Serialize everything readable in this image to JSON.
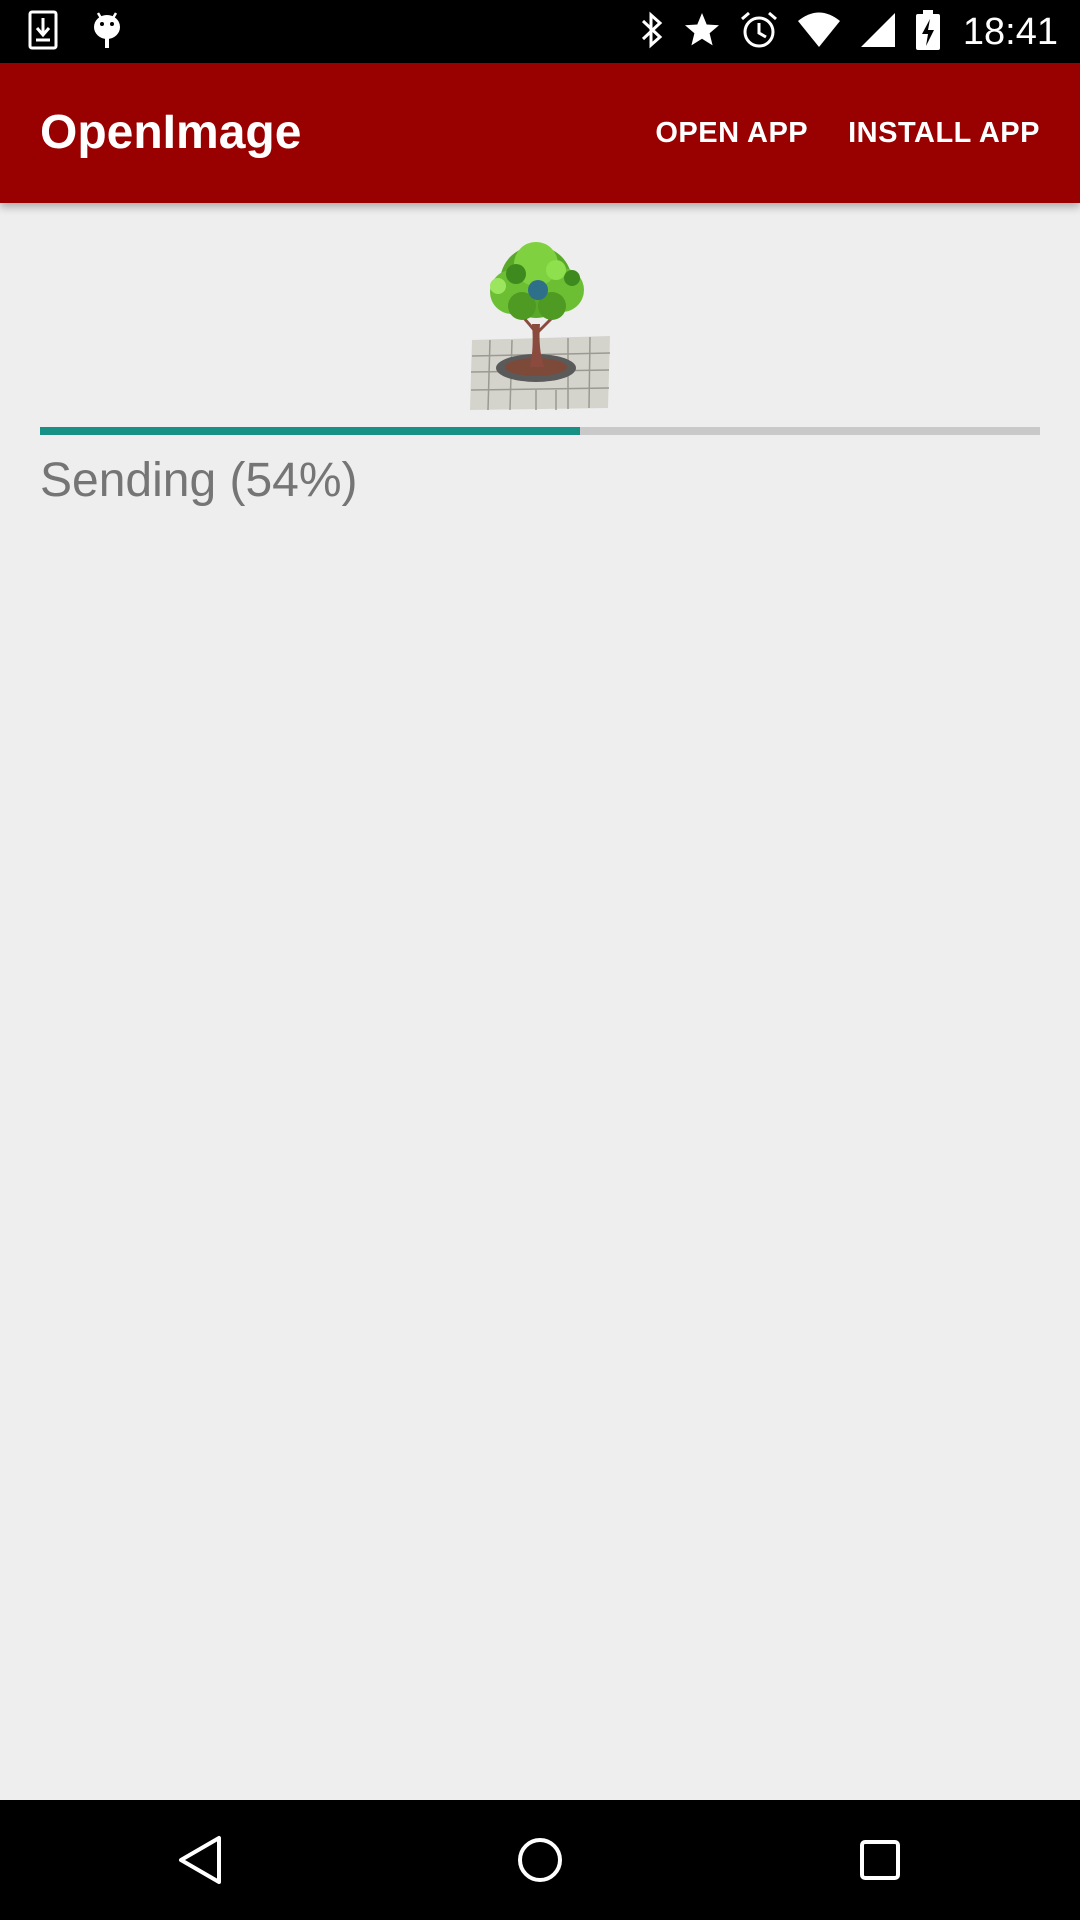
{
  "status_bar": {
    "time": "18:41",
    "left_icons": [
      "download-icon",
      "android-debug-icon"
    ],
    "right_icons": [
      "bluetooth-icon",
      "star-icon",
      "alarm-icon",
      "wifi-icon",
      "signal-icon",
      "battery-charging-icon"
    ]
  },
  "app_bar": {
    "title": "OpenImage",
    "actions": {
      "open_app": "OPEN APP",
      "install_app": "INSTALL APP"
    },
    "color": "#990000"
  },
  "main": {
    "image_icon": "tree-icon",
    "progress_fraction": 0.54,
    "progress_color": "#179185",
    "status_text": "Sending (54%)"
  },
  "nav_bar": {
    "icons": [
      "back-icon",
      "home-icon",
      "recents-icon"
    ]
  }
}
